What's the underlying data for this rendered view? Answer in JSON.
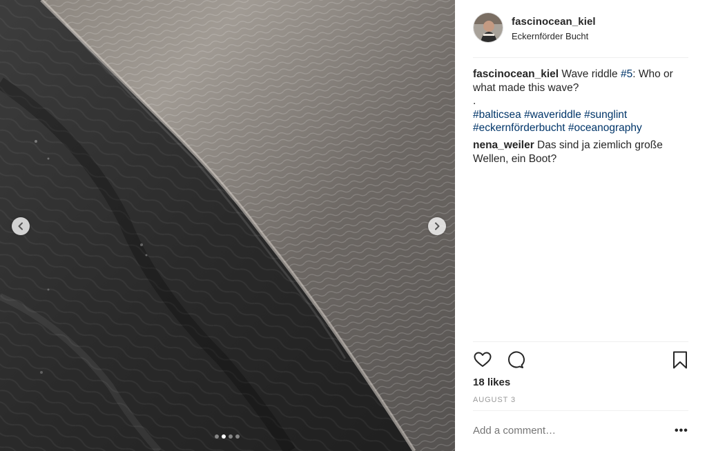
{
  "post": {
    "username": "fascinocean_kiel",
    "location": "Eckernförder Bucht",
    "carousel": {
      "slide_count": 4,
      "active_index": 1
    }
  },
  "caption": {
    "username": "fascinocean_kiel",
    "text_1": " Wave riddle ",
    "hashtag_num": "#5",
    "text_2": ": Who or what made this wave?",
    "dot_line": ".",
    "hashtags": [
      "#balticsea",
      "#waveriddle",
      "#sunglint",
      "#eckernförderbucht",
      "#oceanography"
    ]
  },
  "comments": [
    {
      "username": "nena_weiler",
      "text": " Das sind ja ziemlich große Wellen, ein Boot?"
    }
  ],
  "stats": {
    "likes": "18 likes",
    "date": "AUGUST 3"
  },
  "comment_box": {
    "placeholder": "Add a comment…",
    "more": "•••"
  },
  "icons": {
    "prev": "chevron-left-icon",
    "next": "chevron-right-icon",
    "like": "heart-icon",
    "comment": "speech-bubble-icon",
    "save": "bookmark-icon"
  },
  "colors": {
    "hashtag": "#003569",
    "text": "#262626",
    "muted": "#999999",
    "divider": "#efefef"
  }
}
